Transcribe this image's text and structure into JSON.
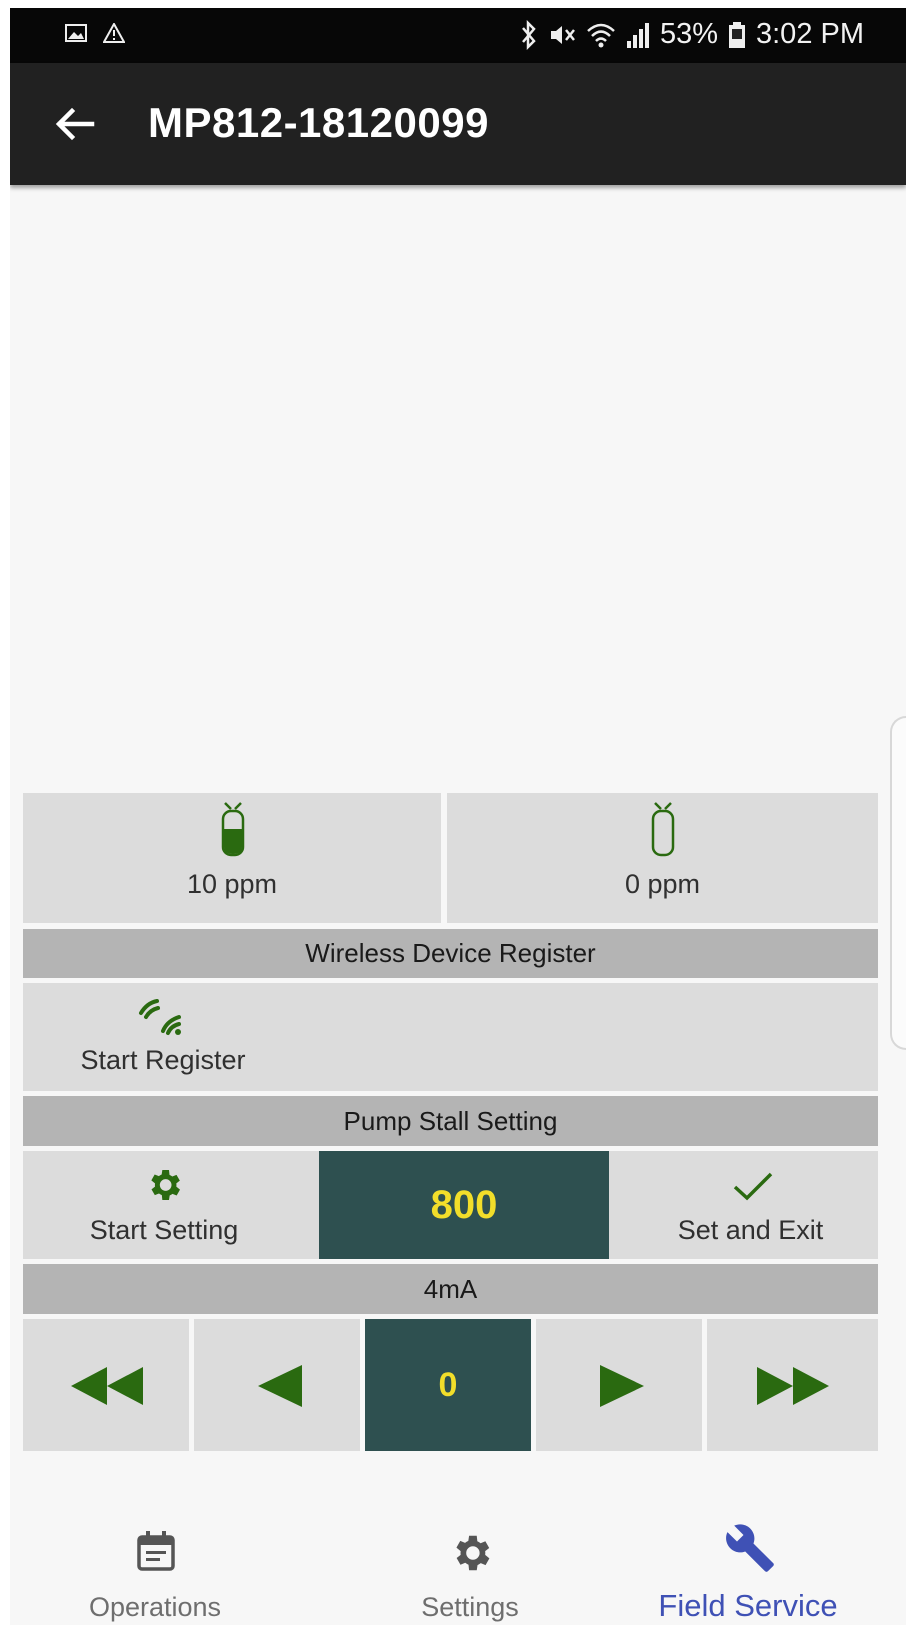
{
  "status_bar": {
    "battery": "53%",
    "time": "3:02 PM",
    "icons": [
      "gallery-icon",
      "warning-triangle-icon",
      "bluetooth-icon",
      "mute-icon",
      "wifi-icon",
      "signal-icon",
      "battery-icon"
    ]
  },
  "app_bar": {
    "title": "MP812-18120099",
    "back_icon": "arrow-left-icon"
  },
  "gas_panel": {
    "left": {
      "icon": "gas-cylinder-filled-icon",
      "value": "10 ppm"
    },
    "right": {
      "icon": "gas-cylinder-empty-icon",
      "value": "0 ppm"
    }
  },
  "wireless": {
    "header": "Wireless Device Register",
    "start_register_label": "Start Register",
    "icon": "wireless-signal-icon"
  },
  "pump_stall": {
    "header": "Pump Stall Setting",
    "start_setting_label": "Start Setting",
    "value": "800",
    "set_and_exit_label": "Set and Exit"
  },
  "four_ma": {
    "header": "4mA",
    "value": "0",
    "controls": [
      "fast-rewind-icon",
      "step-left-icon",
      "step-right-icon",
      "fast-forward-icon"
    ]
  },
  "bottom_nav": {
    "items": [
      {
        "label": "Operations",
        "icon": "calendar-icon"
      },
      {
        "label": "Settings",
        "icon": "gear-icon"
      },
      {
        "label": "Field Service",
        "icon": "wrench-icon",
        "active": true
      }
    ]
  },
  "colors": {
    "accent_green": "#2a6a10",
    "value_yellow": "#f2de2a",
    "value_box": "#2e5050",
    "active_nav": "#3f51b5"
  }
}
